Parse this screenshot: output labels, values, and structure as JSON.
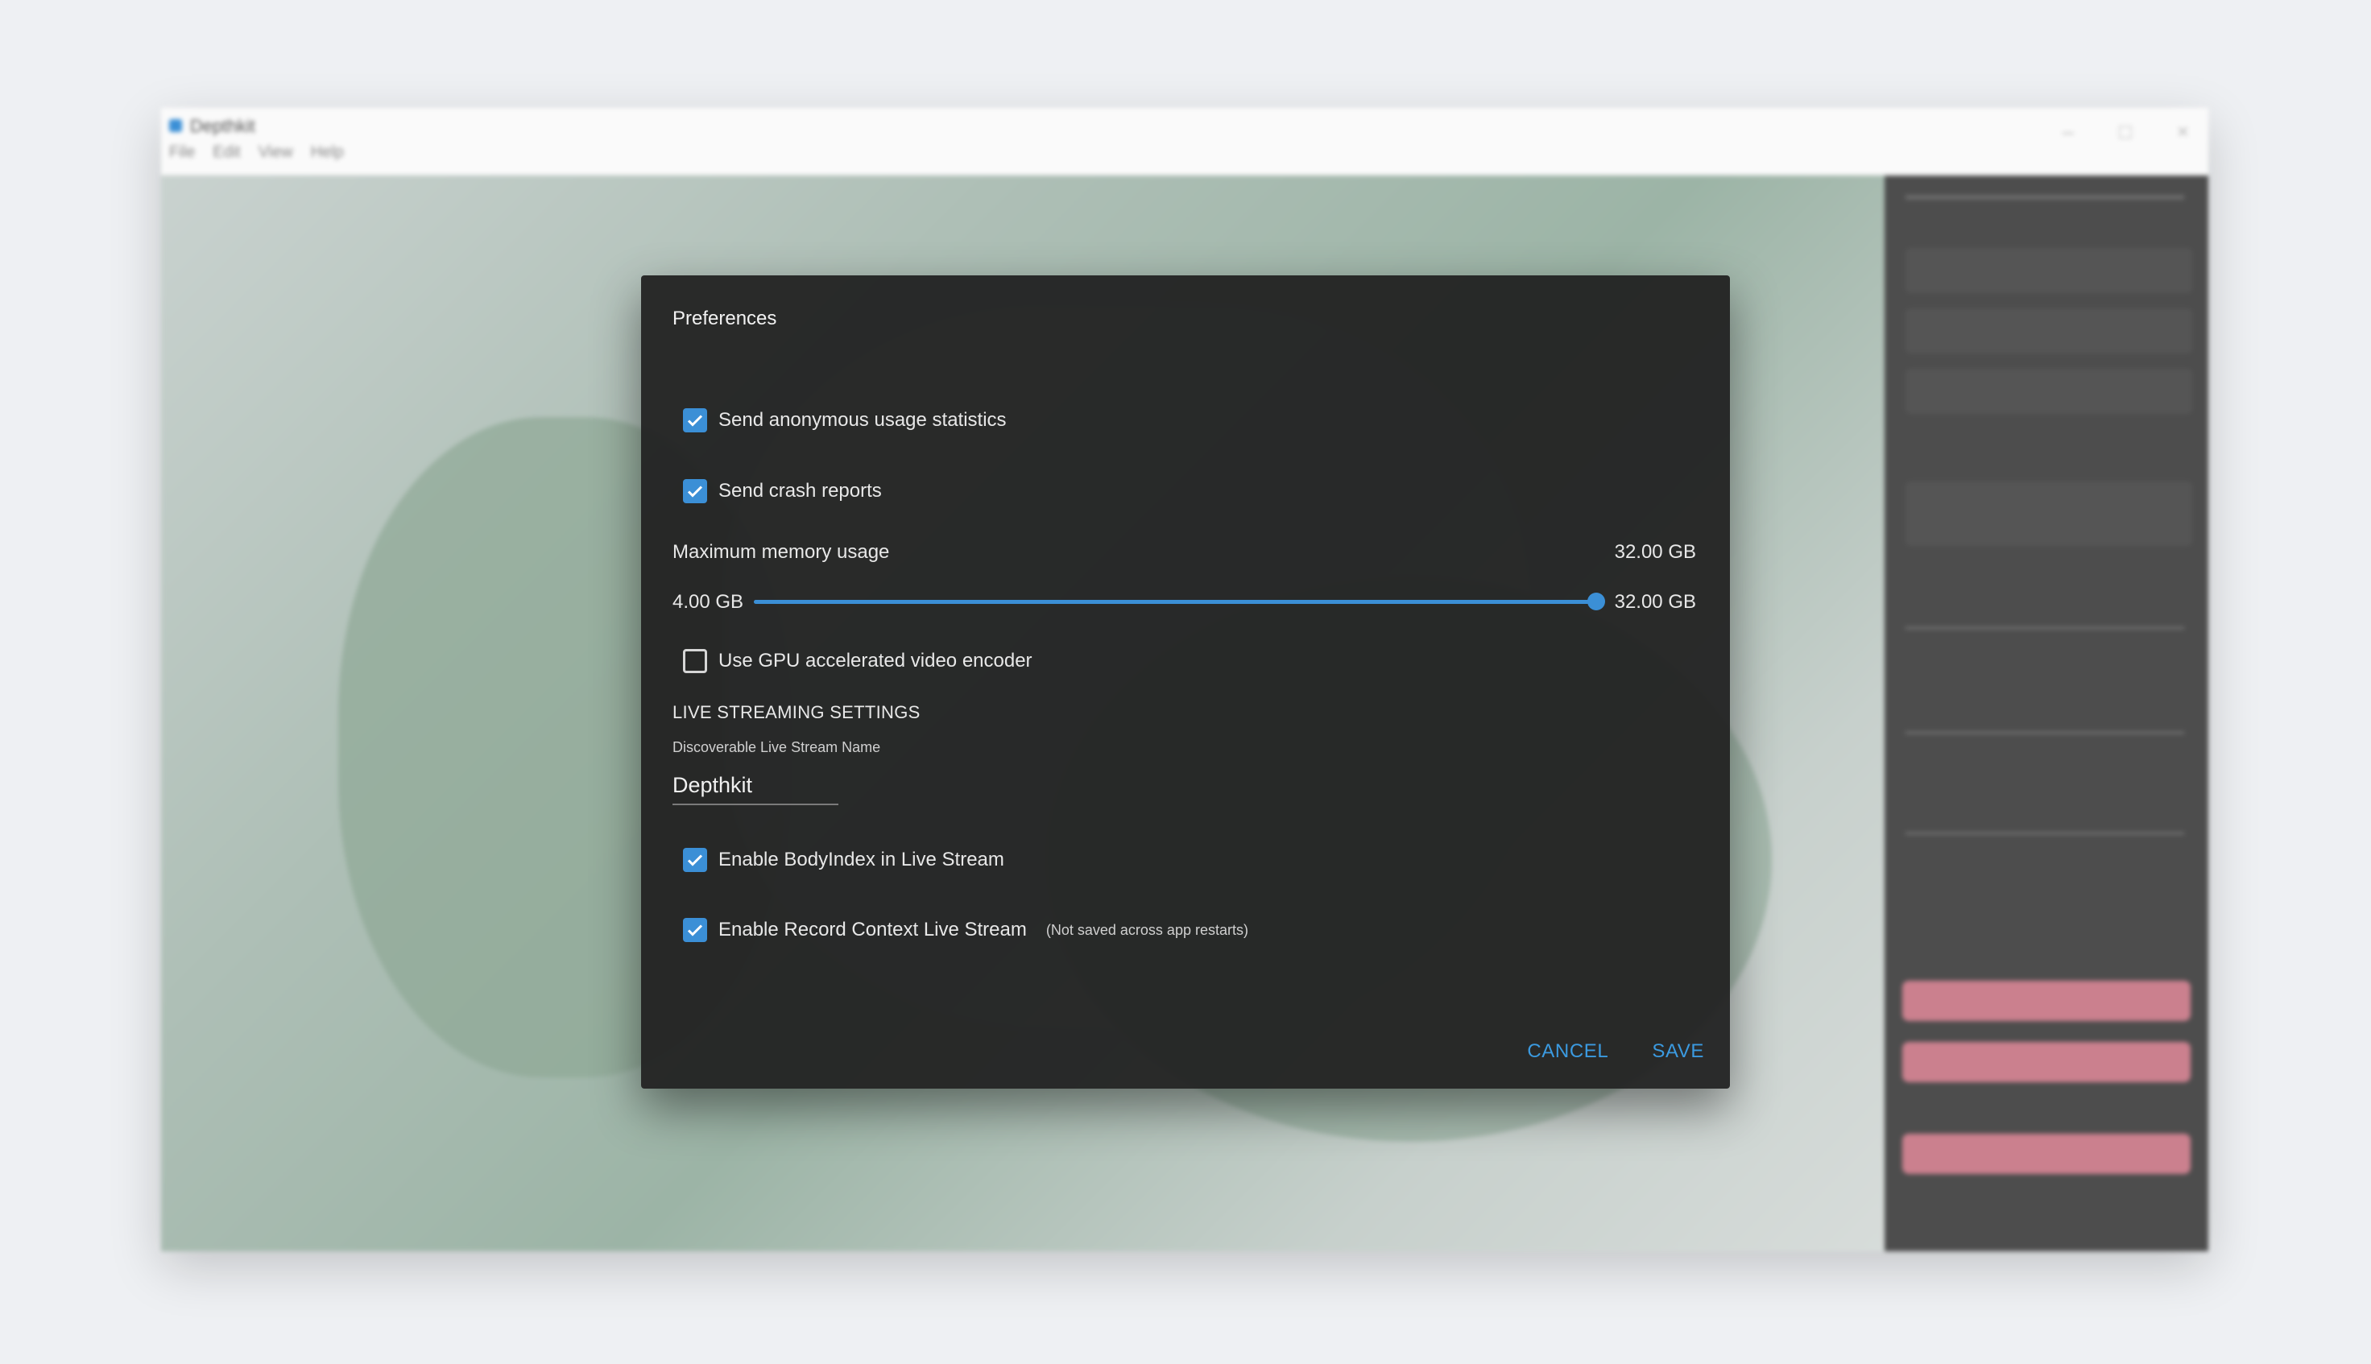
{
  "app": {
    "title": "Depthkit",
    "menu": [
      "File",
      "Edit",
      "View",
      "Help"
    ],
    "window_controls": [
      "minimize-icon",
      "maximize-icon",
      "close-icon"
    ]
  },
  "dialog": {
    "title": "Preferences",
    "send_usage_stats": {
      "label": "Send anonymous usage statistics",
      "checked": true
    },
    "send_crash_reports": {
      "label": "Send crash reports",
      "checked": true
    },
    "memory": {
      "label": "Maximum memory usage",
      "current_display": "32.00 GB",
      "min_label": "4.00 GB",
      "max_label": "32.00 GB",
      "min": 4,
      "max": 32,
      "value": 32
    },
    "gpu_encoder": {
      "label": "Use GPU accelerated video encoder",
      "checked": false
    },
    "live_streaming": {
      "section_title": "LIVE STREAMING SETTINGS",
      "stream_name_label": "Discoverable Live Stream Name",
      "stream_name_value": "Depthkit",
      "body_index": {
        "label": "Enable BodyIndex in Live Stream",
        "checked": true
      },
      "record_context": {
        "label": "Enable Record Context Live Stream",
        "note": "(Not saved across app restarts)",
        "checked": true
      }
    },
    "actions": {
      "cancel": "CANCEL",
      "save": "SAVE"
    }
  },
  "colors": {
    "accent": "#3b8fd6",
    "dialog_bg": "#202020",
    "text": "#e8e8e8"
  }
}
